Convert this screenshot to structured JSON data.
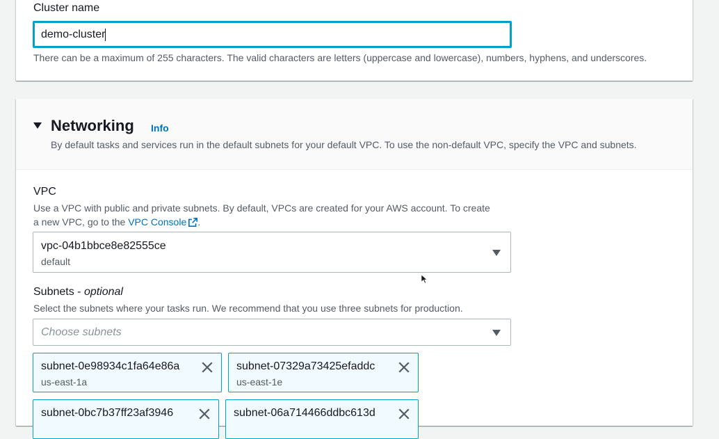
{
  "cluster": {
    "label": "Cluster name",
    "value": "demo-cluster",
    "hint": "There can be a maximum of 255 characters. The valid characters are letters (uppercase and lowercase), numbers, hyphens, and underscores."
  },
  "networking": {
    "title": "Networking",
    "info_label": "Info",
    "description": "By default tasks and services run in the default subnets for your default VPC. To use the non-default VPC, specify the VPC and subnets.",
    "vpc": {
      "label": "VPC",
      "desc_line1": "Use a VPC with public and private subnets. By default, VPCs are created for your AWS account. To create",
      "desc_line2_prefix": "a new VPC, go to the ",
      "console_link": "VPC Console",
      "desc_line2_suffix": ".",
      "selected_id": "vpc-04b1bbce8e82555ce",
      "selected_name": "default"
    },
    "subnets": {
      "label": "Subnets - ",
      "label_optional": "optional",
      "description": "Select the subnets where your tasks run. We recommend that you use three subnets for production.",
      "placeholder": "Choose subnets",
      "selected": [
        {
          "id": "subnet-0e98934c1fa64e86a",
          "az": "us-east-1a"
        },
        {
          "id": "subnet-07329a73425efaddc",
          "az": "us-east-1e"
        },
        {
          "id": "subnet-0bc7b37ff23af3946",
          "az": ""
        },
        {
          "id": "subnet-06a714466ddbc613d",
          "az": ""
        }
      ]
    }
  },
  "icons": {
    "expand": "caret-down-icon",
    "external": "external-link-icon",
    "dropdown": "chevron-down-icon",
    "remove": "close-icon",
    "pointer": "mouse-pointer-icon"
  },
  "colors": {
    "accent": "#00a1c9",
    "link": "#0073bb",
    "token_bg": "#f1faff",
    "page_bg": "#f2f3f3"
  }
}
